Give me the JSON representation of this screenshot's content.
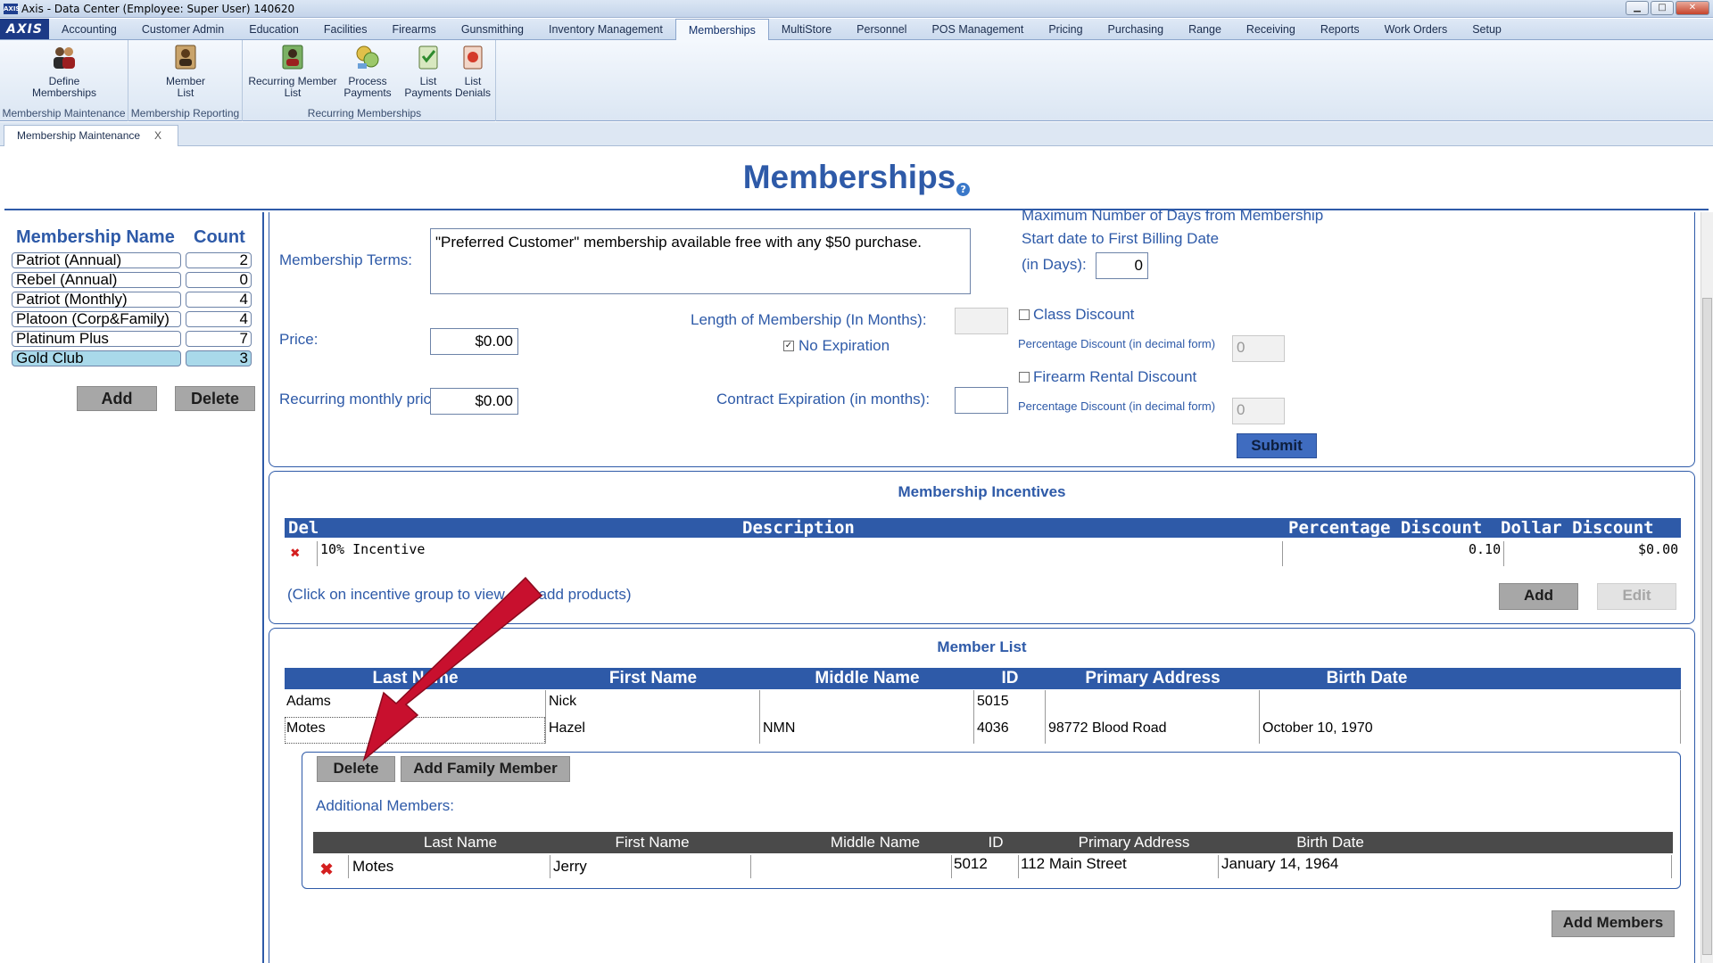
{
  "window": {
    "title": "Axis - Data Center  (Employee: Super User) 140620",
    "app_icon": "AXIS"
  },
  "menu": {
    "logo": "AXIS",
    "tabs": [
      "Accounting",
      "Customer Admin",
      "Education",
      "Facilities",
      "Firearms",
      "Gunsmithing",
      "Inventory Management",
      "Memberships",
      "MultiStore",
      "Personnel",
      "POS Management",
      "Pricing",
      "Purchasing",
      "Range",
      "Receiving",
      "Reports",
      "Work Orders",
      "Setup"
    ],
    "active": "Memberships"
  },
  "ribbon": {
    "define_memberships": "Define Memberships",
    "member_list": "Member List",
    "recurring_member_list": "Recurring Member List",
    "process_payments": "Process Payments",
    "list_payments": "List Payments",
    "list_denials": "List Denials",
    "group_maintenance": "Membership Maintenance",
    "group_reporting": "Membership Reporting",
    "group_recurring": "Recurring Memberships"
  },
  "doc_tab": {
    "label": "Membership Maintenance",
    "close": "X"
  },
  "page": {
    "title": "Memberships",
    "help": "?"
  },
  "membership_list": {
    "name_header": "Membership Name",
    "count_header": "Count",
    "items": [
      {
        "name": "Patriot (Annual)",
        "count": "2"
      },
      {
        "name": "Rebel (Annual)",
        "count": "0"
      },
      {
        "name": "Patriot (Monthly)",
        "count": "4"
      },
      {
        "name": "Platoon (Corp&Family)",
        "count": "4"
      },
      {
        "name": "Platinum Plus",
        "count": "7"
      },
      {
        "name": "Gold Club",
        "count": "3"
      }
    ],
    "selected": "Gold Club",
    "add_label": "Add",
    "delete_label": "Delete"
  },
  "form": {
    "terms_label": "Membership Terms:",
    "terms_value": "\"Preferred Customer\" membership available free with any $50 purchase.",
    "price_label": "Price:",
    "price_value": "$0.00",
    "recurring_label": "Recurring monthly price:",
    "recurring_value": "$0.00",
    "length_label": "Length of Membership (In Months):",
    "length_value": "",
    "no_expiration_label": "No Expiration",
    "no_expiration_checked": true,
    "contract_label": "Contract Expiration (in months):",
    "contract_value": "",
    "max_days_line1": "Maximum Number of Days from Membership",
    "max_days_line2": "Start date to First Billing Date",
    "max_days_line3": "(in Days):",
    "max_days_value": "0",
    "class_discount_label": "Class Discount",
    "class_pct_label": "Percentage Discount (in decimal form)",
    "class_pct_value": "0",
    "rental_discount_label": "Firearm Rental Discount",
    "rental_pct_label": "Percentage Discount (in decimal form)",
    "rental_pct_value": "0",
    "submit_label": "Submit"
  },
  "incentives": {
    "title": "Membership Incentives",
    "headers": {
      "del": "Del",
      "description": "Description",
      "pct": "Percentage Discount",
      "dollar": "Dollar Discount"
    },
    "rows": [
      {
        "description": "10% Incentive",
        "pct": "0.10",
        "dollar": "$0.00"
      }
    ],
    "hint": "(Click on incentive group to view and add products)",
    "add_label": "Add",
    "edit_label": "Edit"
  },
  "member_list": {
    "title": "Member List",
    "headers": {
      "last": "Last Name",
      "first": "First Name",
      "middle": "Middle Name",
      "id": "ID",
      "address": "Primary Address",
      "birth": "Birth Date"
    },
    "rows": [
      {
        "last": "Adams",
        "first": "Nick",
        "middle": "",
        "id": "5015",
        "address": "",
        "birth": ""
      },
      {
        "last": "Motes",
        "first": "Hazel",
        "middle": "NMN",
        "id": "4036",
        "address": "98772 Blood Road",
        "birth": "October 10, 1970"
      }
    ],
    "delete_label": "Delete",
    "add_family_label": "Add Family Member",
    "additional_label": "Additional Members:",
    "family_headers": {
      "last": "Last Name",
      "first": "First Name",
      "middle": "Middle Name",
      "id": "ID",
      "address": "Primary Address",
      "birth": "Birth Date"
    },
    "family_rows": [
      {
        "last": "Motes",
        "first": "Jerry",
        "middle": "",
        "id": "5012",
        "address": "112 Main Street",
        "birth": "January 14, 1964"
      }
    ],
    "add_members_label": "Add Members"
  },
  "colors": {
    "accent": "#2e5aa8",
    "annotation_arrow": "#c8102e",
    "selected_row": "#a9d9ea"
  }
}
